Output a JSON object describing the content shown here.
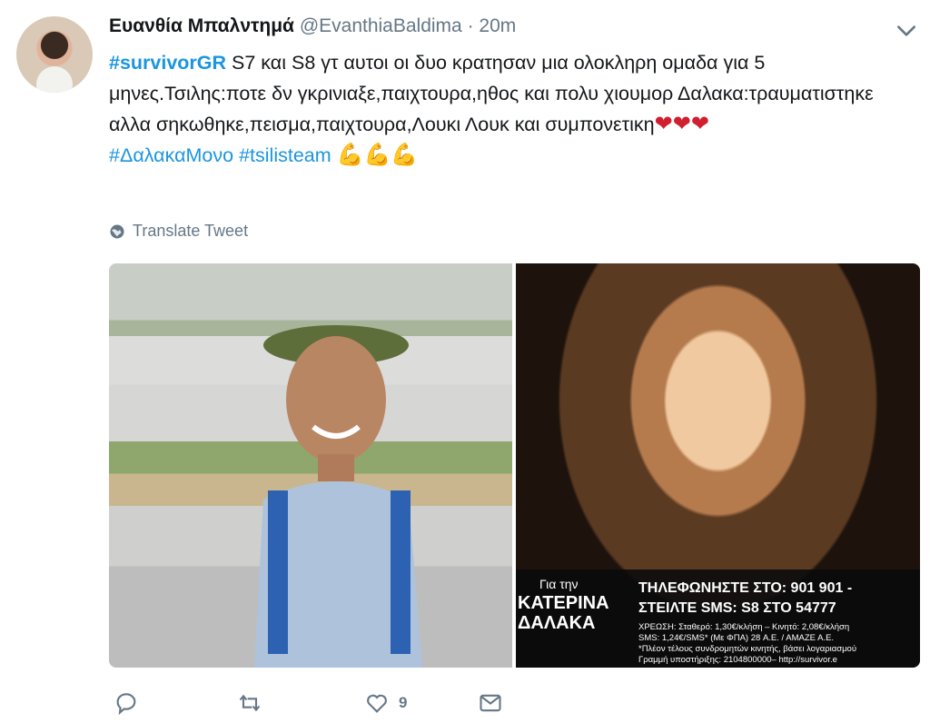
{
  "tweet": {
    "display_name": "Ευανθία Μπαλντημά",
    "handle": "@EvanthiaBaldima",
    "separator": "·",
    "time": "20m",
    "text": {
      "hashtag_1": "#survivorGR",
      "line_1_rest": " S7 και S8 γτ αυτοι οι δυο κρατησαν μια ολοκληρη ομαδα για 5 μηνες.Τσιλης:ποτε δν γκρινιαξε,παιχτουρα,ηθος και πολυ χιουμορ Δαλακα:τραυματιστηκε αλλα σηκωθηκε,πεισμα,παιχτουρα,Λουκι Λουκ και συμπονετικη",
      "hearts": "❤❤❤",
      "hashtag_2": "#ΔαλακαΜονο",
      "hashtag_3": "#tsilisteam",
      "arms": "💪💪💪"
    },
    "translate_label": "Translate Tweet",
    "media": {
      "overlay_small": "Για την",
      "overlay_name_1": "ΚΑΤΕΡΙΝΑ",
      "overlay_name_2": "ΔΑΛΑΚΑ",
      "overlay_phone": "ΤΗΛΕΦΩΝΗΣΤΕ ΣΤΟ: 901 901 -",
      "overlay_sms": "ΣΤΕΙΛΤΕ SMS: S8 ΣΤΟ 54777",
      "overlay_fine_1": "ΧΡΕΩΣΗ: Σταθερό: 1,30€/κλήση – Κινητό: 2,08€/κλήση",
      "overlay_fine_2": "SMS: 1,24€/SMS* (Με ΦΠΑ) 28 Α.Ε. / ΑΜΑΖΕ Α.Ε.",
      "overlay_fine_3": "*Πλέον τέλους συνδρομητών κινητής, βάσει λογαριασμού",
      "overlay_fine_4": "Γραμμή υποστήριξης: 2104800000– http://survivor.e"
    },
    "actions": {
      "reply_icon": "reply-icon",
      "retweet_icon": "retweet-icon",
      "like_icon": "heart-icon",
      "like_count": "9",
      "dm_icon": "envelope-icon"
    }
  },
  "colors": {
    "link": "#1b95e0",
    "secondary": "#657786",
    "text": "#14171a"
  }
}
